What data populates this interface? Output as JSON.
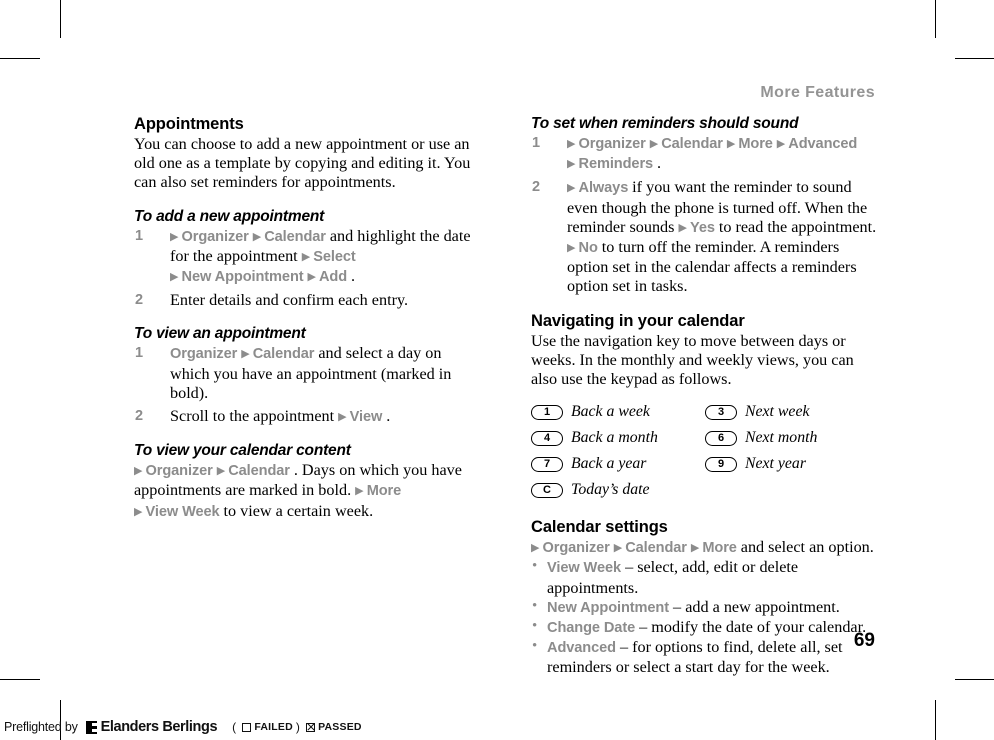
{
  "running_header": "More Features",
  "page_number": "69",
  "arrow_glyph": "▶",
  "bullet_glyph": "•",
  "colors": {
    "menu_gray": "#8c8c8c",
    "header_gray": "#949494",
    "text_black": "#000000"
  },
  "left_column": {
    "section_title": "Appointments",
    "intro": "You can choose to add a new appointment or use an old one as a template by copying and editing it. You can also set reminders for appointments.",
    "procedures": [
      {
        "title": "To add a new appointment",
        "steps": [
          {
            "number": "1",
            "parts": [
              {
                "type": "arrow"
              },
              {
                "type": "menu",
                "text": "Organizer"
              },
              {
                "type": "arrow"
              },
              {
                "type": "menu",
                "text": "Calendar"
              },
              {
                "type": "text",
                "text": " and highlight the date for the appointment "
              },
              {
                "type": "arrow"
              },
              {
                "type": "menu",
                "text": "Select"
              },
              {
                "type": "break"
              },
              {
                "type": "arrow"
              },
              {
                "type": "menu",
                "text": "New Appointment"
              },
              {
                "type": "arrow"
              },
              {
                "type": "menu",
                "text": "Add"
              },
              {
                "type": "text",
                "text": "."
              }
            ]
          },
          {
            "number": "2",
            "parts": [
              {
                "type": "text",
                "text": "Enter details and confirm each entry."
              }
            ]
          }
        ]
      },
      {
        "title": "To view an appointment",
        "steps": [
          {
            "number": "1",
            "parts": [
              {
                "type": "menu",
                "text": "Organizer"
              },
              {
                "type": "arrow"
              },
              {
                "type": "menu",
                "text": "Calendar"
              },
              {
                "type": "text",
                "text": " and select a day on which you have an appointment (marked in bold)."
              }
            ]
          },
          {
            "number": "2",
            "parts": [
              {
                "type": "text",
                "text": "Scroll to the appointment "
              },
              {
                "type": "arrow"
              },
              {
                "type": "menu",
                "text": "View"
              },
              {
                "type": "text",
                "text": "."
              }
            ]
          }
        ]
      },
      {
        "title": "To view your calendar content",
        "paragraph_parts": [
          {
            "type": "arrow"
          },
          {
            "type": "menu",
            "text": "Organizer"
          },
          {
            "type": "arrow"
          },
          {
            "type": "menu",
            "text": "Calendar"
          },
          {
            "type": "text",
            "text": ". Days on which you have appointments are marked in bold. "
          },
          {
            "type": "arrow"
          },
          {
            "type": "menu",
            "text": "More"
          },
          {
            "type": "break"
          },
          {
            "type": "arrow"
          },
          {
            "type": "menu",
            "text": "View Week"
          },
          {
            "type": "text",
            "text": " to view a certain week."
          }
        ]
      }
    ]
  },
  "right_column": {
    "procedure": {
      "title": "To set when reminders should sound",
      "steps": [
        {
          "number": "1",
          "parts": [
            {
              "type": "arrow"
            },
            {
              "type": "menu",
              "text": "Organizer"
            },
            {
              "type": "arrow"
            },
            {
              "type": "menu",
              "text": "Calendar"
            },
            {
              "type": "arrow"
            },
            {
              "type": "menu",
              "text": "More"
            },
            {
              "type": "arrow"
            },
            {
              "type": "menu",
              "text": "Advanced"
            },
            {
              "type": "break"
            },
            {
              "type": "arrow"
            },
            {
              "type": "menu",
              "text": "Reminders"
            },
            {
              "type": "text",
              "text": "."
            }
          ]
        },
        {
          "number": "2",
          "parts": [
            {
              "type": "arrow"
            },
            {
              "type": "menu",
              "text": "Always"
            },
            {
              "type": "text",
              "text": " if you want the reminder to sound even though the phone is turned off. When the reminder sounds "
            },
            {
              "type": "arrow"
            },
            {
              "type": "menu",
              "text": "Yes"
            },
            {
              "type": "text",
              "text": " to read the appointment. "
            },
            {
              "type": "arrow"
            },
            {
              "type": "menu",
              "text": "No"
            },
            {
              "type": "text",
              "text": " to turn off the reminder. A reminders option set in the calendar affects a reminders option set in tasks."
            }
          ]
        }
      ]
    },
    "navigating": {
      "title": "Navigating in your calendar",
      "intro": "Use the navigation key to move between days or weeks. In the monthly and weekly views, you can also use the keypad as follows.",
      "key_rows": [
        [
          {
            "key": "1",
            "label": "Back a week"
          },
          {
            "key": "3",
            "label": "Next week"
          }
        ],
        [
          {
            "key": "4",
            "label": "Back a month"
          },
          {
            "key": "6",
            "label": "Next month"
          }
        ],
        [
          {
            "key": "7",
            "label": "Back a year"
          },
          {
            "key": "9",
            "label": "Next year"
          }
        ],
        [
          {
            "key": "C",
            "label": "Today’s date"
          }
        ]
      ]
    },
    "settings": {
      "title": "Calendar settings",
      "lead_parts": [
        {
          "type": "arrow"
        },
        {
          "type": "menu",
          "text": "Organizer"
        },
        {
          "type": "arrow"
        },
        {
          "type": "menu",
          "text": "Calendar"
        },
        {
          "type": "arrow"
        },
        {
          "type": "menu",
          "text": "More"
        },
        {
          "type": "text",
          "text": " and select an option."
        }
      ],
      "items": [
        {
          "term": "View Week",
          "desc": " – select, add, edit or delete appointments."
        },
        {
          "term": "New Appointment",
          "desc": " – add a new appointment."
        },
        {
          "term": "Change Date",
          "desc": " – modify the date of your calendar."
        },
        {
          "term": "Advanced",
          "desc": " – for options to find, delete all, set reminders or select a start day for the week."
        }
      ]
    }
  },
  "preflight": {
    "label": "Preflighted by",
    "brand": "Elanders Berlings",
    "open_paren": "(",
    "failed_label": "FAILED",
    "close_paren": ")",
    "passed_label": "PASSED"
  }
}
